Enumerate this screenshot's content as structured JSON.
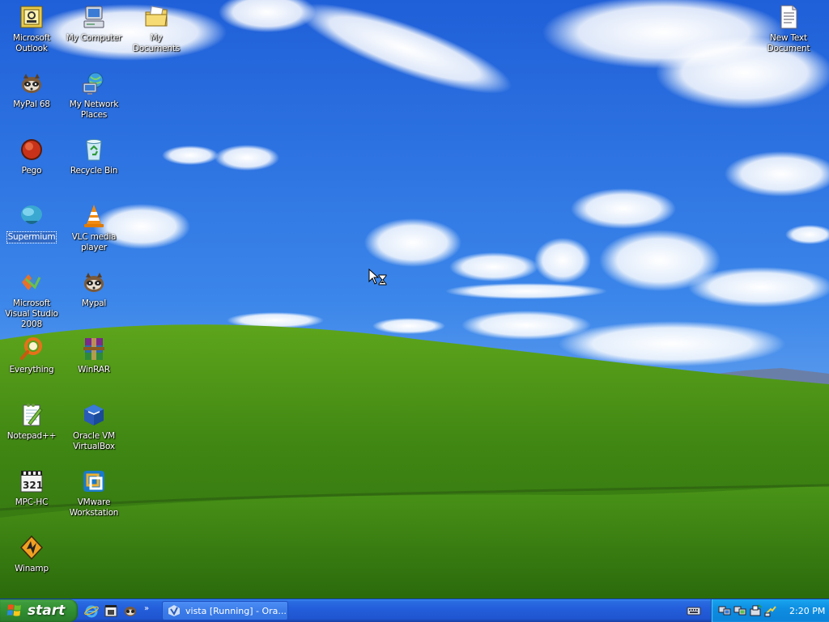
{
  "desktop": {
    "icons": [
      {
        "label": "Microsoft Outlook",
        "icon": "outlook-icon"
      },
      {
        "label": "My Computer",
        "icon": "my-computer-icon"
      },
      {
        "label": "My Documents",
        "icon": "my-documents-icon"
      },
      {
        "label": "New Text Document",
        "icon": "text-document-icon"
      },
      {
        "label": "MyPal 68",
        "icon": "mypal-icon"
      },
      {
        "label": "My Network Places",
        "icon": "network-places-icon"
      },
      {
        "label": "Pego",
        "icon": "pego-icon"
      },
      {
        "label": "Recycle Bin",
        "icon": "recycle-bin-icon"
      },
      {
        "label": "Supermium",
        "icon": "supermium-icon",
        "selected": true
      },
      {
        "label": "VLC media player",
        "icon": "vlc-icon"
      },
      {
        "label": "Microsoft Visual Studio 2008",
        "icon": "visual-studio-icon"
      },
      {
        "label": "Mypal",
        "icon": "mypal-icon"
      },
      {
        "label": "Everything",
        "icon": "everything-search-icon"
      },
      {
        "label": "WinRAR",
        "icon": "winrar-icon"
      },
      {
        "label": "Notepad++",
        "icon": "notepad-plus-plus-icon"
      },
      {
        "label": "Oracle VM VirtualBox",
        "icon": "virtualbox-icon"
      },
      {
        "label": "MPC-HC",
        "icon": "mpc-hc-icon"
      },
      {
        "label": "VMware Workstation",
        "icon": "vmware-icon"
      },
      {
        "label": "Winamp",
        "icon": "winamp-icon"
      }
    ]
  },
  "taskbar": {
    "start_label": "start",
    "quicklaunch": [
      "internet-explorer-icon",
      "media-icon",
      "mypal-icon"
    ],
    "quicklaunch_more": "»",
    "tasks": [
      {
        "label": "vista [Running] - Ora...",
        "icon": "virtualbox-icon"
      }
    ],
    "tray_icons": [
      "network-icon",
      "network-icon",
      "safely-remove-hardware-icon",
      "power-icon"
    ],
    "clock": "2:20 PM"
  },
  "colors": {
    "taskbar_blue": "#245edb",
    "start_green": "#3c9a3c",
    "tray_blue": "#0e8ee2",
    "selection_blue": "#316ac5"
  }
}
